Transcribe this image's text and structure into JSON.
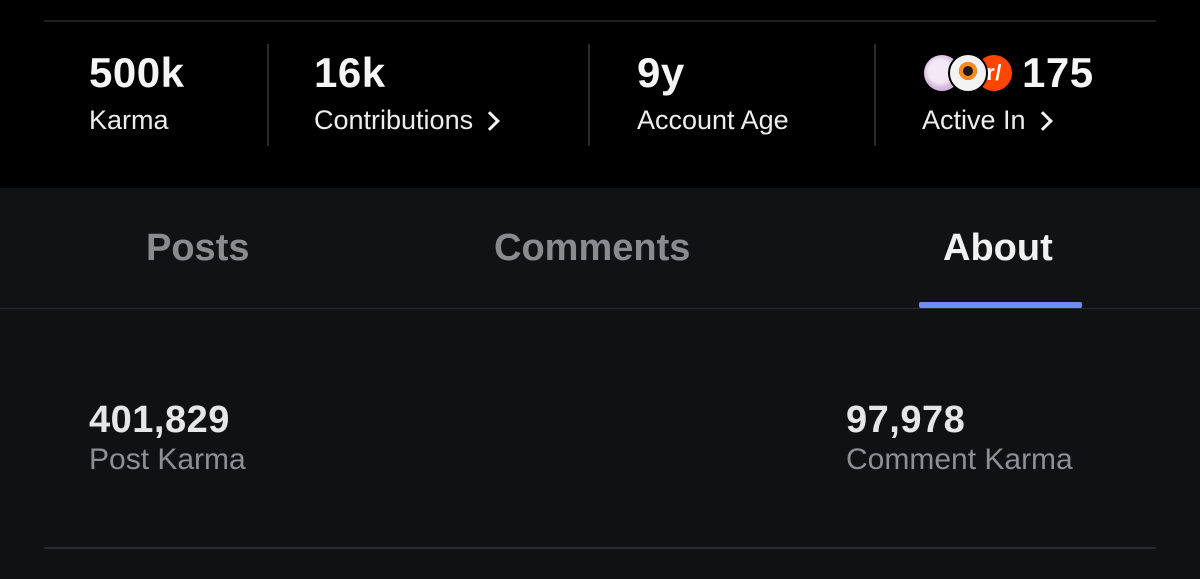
{
  "stats": {
    "karma": {
      "value": "500k",
      "label": "Karma"
    },
    "contributions": {
      "value": "16k",
      "label": "Contributions"
    },
    "account_age": {
      "value": "9y",
      "label": "Account Age"
    },
    "active_in": {
      "value": "175",
      "label": "Active In",
      "avatar_r_text": "r/"
    }
  },
  "tabs": [
    {
      "label": "Posts",
      "active": false
    },
    {
      "label": "Comments",
      "active": false
    },
    {
      "label": "About",
      "active": true
    }
  ],
  "about": {
    "post_karma": {
      "value": "401,829",
      "label": "Post Karma"
    },
    "comment_karma": {
      "value": "97,978",
      "label": "Comment Karma"
    }
  },
  "colors": {
    "accent": "#6f8cf6",
    "background": "#000000",
    "panel": "#111214",
    "reddit_orange": "#ff4500"
  },
  "icons": {
    "contributions_chevron": "chevron-right-icon",
    "active_in_chevron": "chevron-right-icon"
  }
}
